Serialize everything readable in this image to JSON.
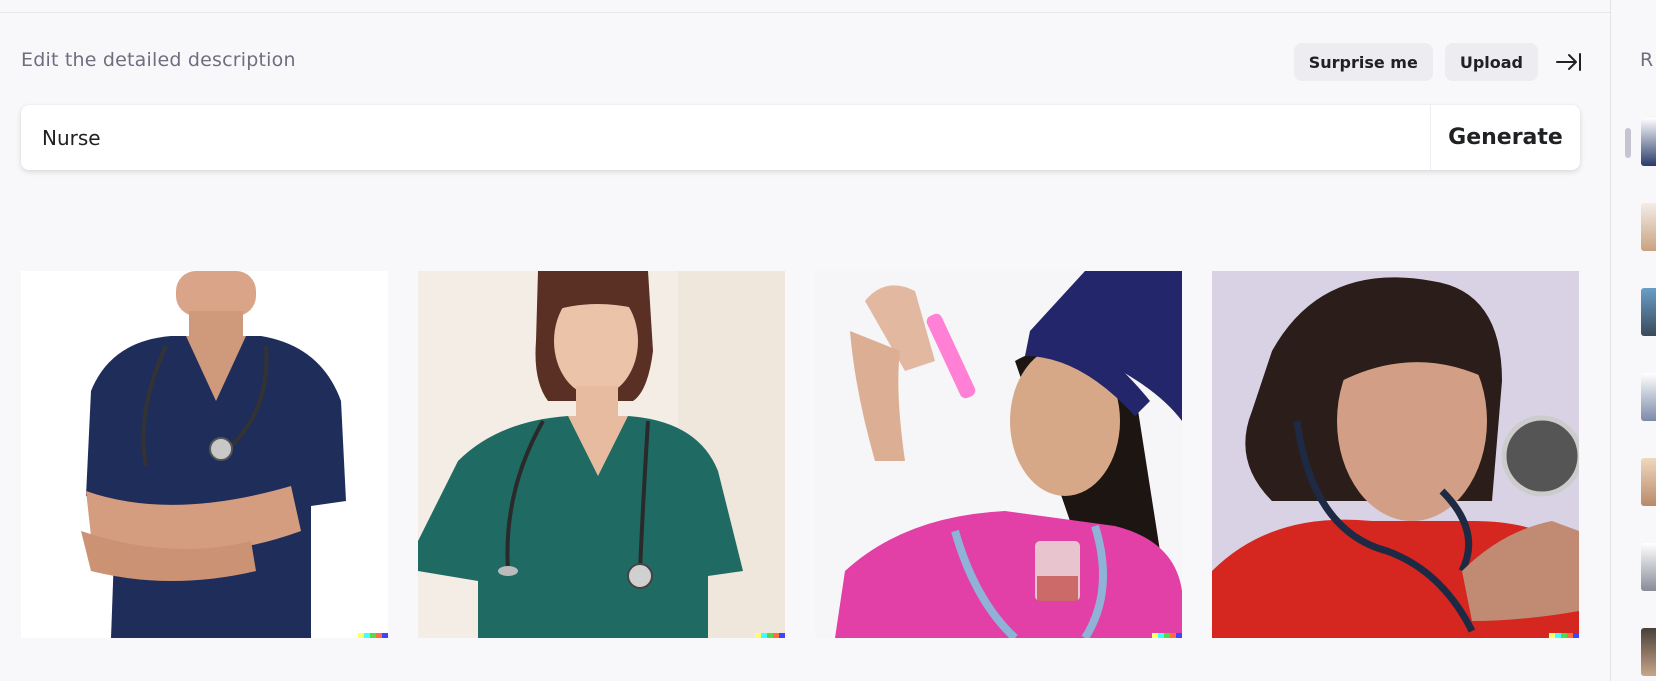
{
  "header": {
    "description_label": "Edit the detailed description",
    "surprise_label": "Surprise me",
    "upload_label": "Upload",
    "collapse_icon": "arrow-right-to-line-icon"
  },
  "prompt": {
    "value": "Nurse",
    "generate_label": "Generate"
  },
  "results": [
    {
      "subject": "man in navy scrubs with stethoscope, arms crossed"
    },
    {
      "subject": "woman in teal scrubs with stethoscope"
    },
    {
      "subject": "woman in pink scrubs and navy cap holding syringe"
    },
    {
      "subject": "woman in red scrubs using stethoscope"
    }
  ],
  "sidebar": {
    "title": "R",
    "thumbnail_count": 7
  },
  "colors": {
    "background": "#f8f8fa",
    "button_bg": "#ececf1",
    "label_gray": "#6e6e80",
    "text": "#202123"
  }
}
